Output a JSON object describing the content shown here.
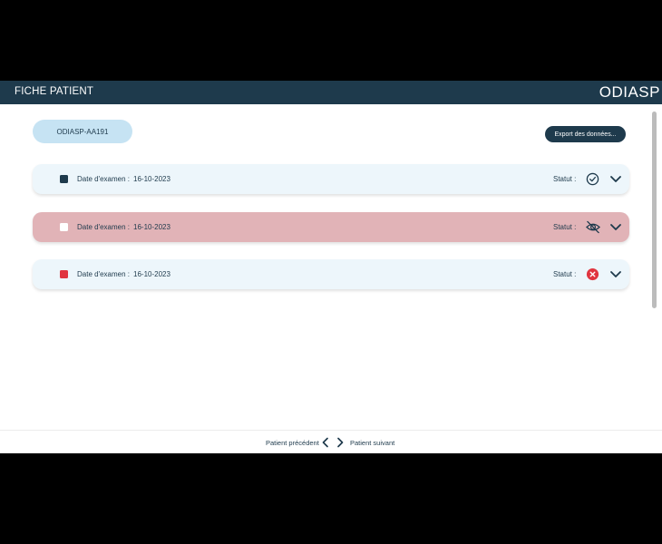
{
  "header": {
    "title": "FICHE PATIENT",
    "logo": "ODIASP"
  },
  "patient": {
    "id": "ODIASP-AA191"
  },
  "toolbar": {
    "export_label": "Export des données..."
  },
  "exams": [
    {
      "date_label": "Date d'examen :",
      "date": "16-10-2023",
      "status_label": "Statut :",
      "status_icon": "check-circle-icon",
      "swatch_color": "#1e3a4c",
      "row_color": "#edf6fb"
    },
    {
      "date_label": "Date d'examen :",
      "date": "16-10-2023",
      "status_label": "Statut :",
      "status_icon": "eye-off-icon",
      "swatch_color": "#ffffff",
      "row_color": "#e1b3b7"
    },
    {
      "date_label": "Date d'examen :",
      "date": "16-10-2023",
      "status_label": "Statut :",
      "status_icon": "error-x-circle-icon",
      "swatch_color": "#e0353f",
      "row_color": "#edf6fb"
    }
  ],
  "footer": {
    "prev_label": "Patient précédent",
    "next_label": "Patient suivant"
  },
  "colors": {
    "header_bg": "#1e3a4c",
    "accent_light": "#c6e3f3",
    "error": "#e0353f"
  }
}
